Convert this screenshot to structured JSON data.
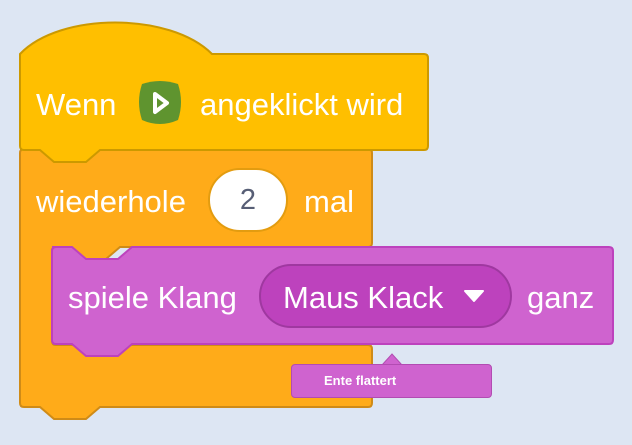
{
  "hat_block": {
    "label_before": "Wenn",
    "label_after": "angeklickt wird",
    "flag_icon": "green-flag-icon"
  },
  "repeat_block": {
    "label_before": "wiederhole",
    "count_value": "2",
    "label_after": "mal"
  },
  "sound_block": {
    "label_before": "spiele Klang",
    "selected_sound": "Maus Klack",
    "label_after": "ganz",
    "dropdown_icon": "caret-down-icon"
  },
  "dropdown_menu": {
    "items": [
      "Ente flattert"
    ]
  },
  "colors": {
    "background": "#dde6f3",
    "events": "#ffbf00",
    "control": "#ffab19",
    "sound": "#cf63cf",
    "sound_dark": "#bd42bd",
    "flag_bg": "#5f942f"
  }
}
